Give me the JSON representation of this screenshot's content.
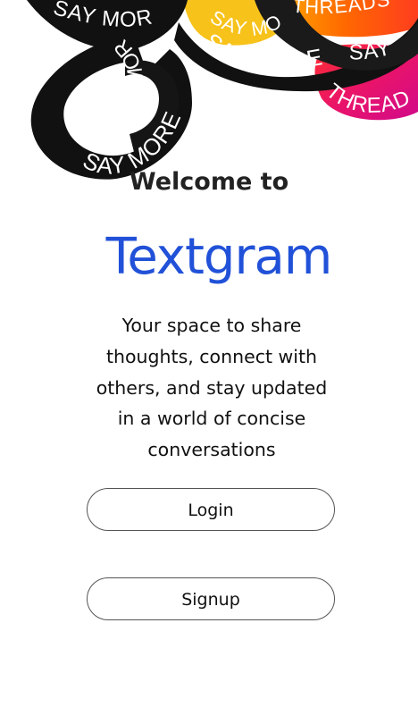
{
  "hero": {
    "ribbon_texts": [
      "SAY MORE",
      "SAY MORE",
      "SAY MORE",
      "SAY MORE",
      "THREADS",
      "THREADS",
      "SAY",
      "SAY MO"
    ],
    "ribbon_colors": {
      "black": "#111111",
      "yellow": "#f7c61a",
      "orange": "#ff7a12",
      "magenta": "#e2126b",
      "red": "#f01a2a"
    }
  },
  "welcome": {
    "heading": "Welcome to",
    "brand": "Textgram",
    "tagline": "Your space to share thoughts, connect with others, and stay updated in a world of concise conversations"
  },
  "actions": {
    "login_label": "Login",
    "signup_label": "Signup"
  },
  "colors": {
    "brand": "#2151d8",
    "text": "#222222",
    "button_border": "#555555",
    "background": "#ffffff"
  }
}
